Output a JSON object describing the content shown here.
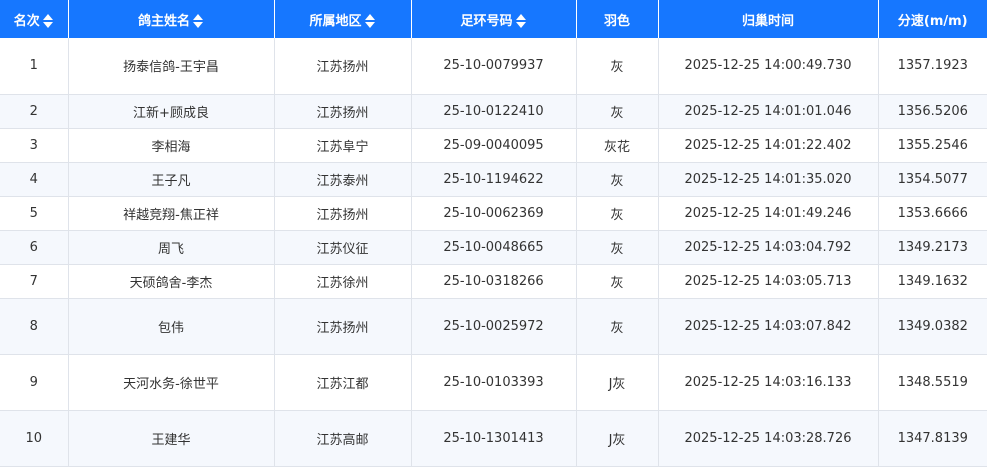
{
  "table": {
    "headers": {
      "rank": "名次",
      "owner": "鸽主姓名",
      "region": "所属地区",
      "ring": "足环号码",
      "color": "羽色",
      "time": "归巢时间",
      "speed": "分速(m/m)"
    },
    "rows": [
      {
        "rank": "1",
        "owner": "扬泰信鸽-王宇昌",
        "region": "江苏扬州",
        "ring": "25-10-0079937",
        "color": "灰",
        "time": "2025-12-25 14:00:49.730",
        "speed": "1357.1923"
      },
      {
        "rank": "2",
        "owner": "江新+顾成良",
        "region": "江苏扬州",
        "ring": "25-10-0122410",
        "color": "灰",
        "time": "2025-12-25 14:01:01.046",
        "speed": "1356.5206"
      },
      {
        "rank": "3",
        "owner": "李相海",
        "region": "江苏阜宁",
        "ring": "25-09-0040095",
        "color": "灰花",
        "time": "2025-12-25 14:01:22.402",
        "speed": "1355.2546"
      },
      {
        "rank": "4",
        "owner": "王子凡",
        "region": "江苏泰州",
        "ring": "25-10-1194622",
        "color": "灰",
        "time": "2025-12-25 14:01:35.020",
        "speed": "1354.5077"
      },
      {
        "rank": "5",
        "owner": "祥越竞翔-焦正祥",
        "region": "江苏扬州",
        "ring": "25-10-0062369",
        "color": "灰",
        "time": "2025-12-25 14:01:49.246",
        "speed": "1353.6666"
      },
      {
        "rank": "6",
        "owner": "周飞",
        "region": "江苏仪征",
        "ring": "25-10-0048665",
        "color": "灰",
        "time": "2025-12-25 14:03:04.792",
        "speed": "1349.2173"
      },
      {
        "rank": "7",
        "owner": "天硕鸽舍-李杰",
        "region": "江苏徐州",
        "ring": "25-10-0318266",
        "color": "灰",
        "time": "2025-12-25 14:03:05.713",
        "speed": "1349.1632"
      },
      {
        "rank": "8",
        "owner": "包伟",
        "region": "江苏扬州",
        "ring": "25-10-0025972",
        "color": "灰",
        "time": "2025-12-25 14:03:07.842",
        "speed": "1349.0382"
      },
      {
        "rank": "9",
        "owner": "天河水务-徐世平",
        "region": "江苏江都",
        "ring": "25-10-0103393",
        "color": "J灰",
        "time": "2025-12-25 14:03:16.133",
        "speed": "1348.5519"
      },
      {
        "rank": "10",
        "owner": "王建华",
        "region": "江苏高邮",
        "ring": "25-10-1301413",
        "color": "J灰",
        "time": "2025-12-25 14:03:28.726",
        "speed": "1347.8139"
      }
    ]
  },
  "colors": {
    "header_bg": "#1677ff",
    "alt_row_bg": "#f5f8fd",
    "border": "#dfe3ea"
  },
  "icons": {
    "sort": "sort-icon"
  }
}
